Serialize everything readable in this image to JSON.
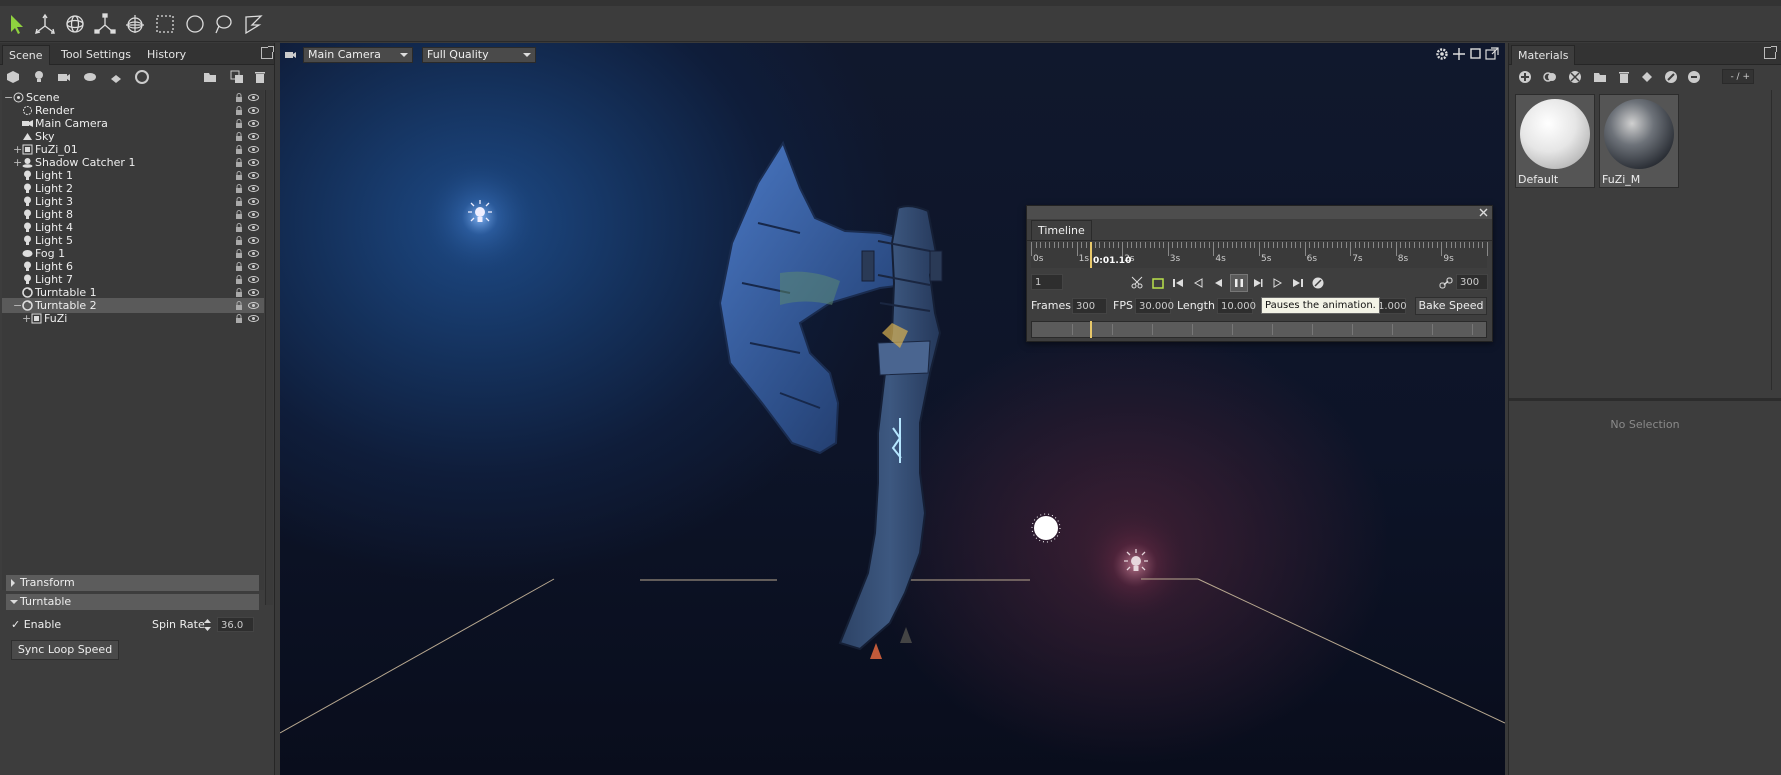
{
  "toolbar": {
    "tools": [
      "select-tool",
      "move-tool",
      "rotate-tool",
      "scale-tool",
      "transform-tool",
      "box-select-tool",
      "circle-select-tool",
      "lasso-select-tool",
      "paint-select-tool"
    ]
  },
  "left_panel": {
    "tabs": [
      "Scene",
      "Tool Settings",
      "History"
    ],
    "tree": [
      {
        "label": "Scene",
        "level": 0,
        "expander": "−",
        "icon": "scene-icon"
      },
      {
        "label": "Render",
        "level": 1,
        "expander": "",
        "icon": "render-icon"
      },
      {
        "label": "Main Camera",
        "level": 1,
        "expander": "",
        "icon": "camera-icon"
      },
      {
        "label": "Sky",
        "level": 1,
        "expander": "",
        "icon": "sky-icon"
      },
      {
        "label": "FuZi_01",
        "level": 1,
        "expander": "+",
        "icon": "mesh-icon"
      },
      {
        "label": "Shadow Catcher 1",
        "level": 1,
        "expander": "+",
        "icon": "shadow-catcher-icon"
      },
      {
        "label": "Light 1",
        "level": 1,
        "expander": "",
        "icon": "light-icon"
      },
      {
        "label": "Light 2",
        "level": 1,
        "expander": "",
        "icon": "light-icon"
      },
      {
        "label": "Light 3",
        "level": 1,
        "expander": "",
        "icon": "light-icon"
      },
      {
        "label": "Light 8",
        "level": 1,
        "expander": "",
        "icon": "light-icon"
      },
      {
        "label": "Light 4",
        "level": 1,
        "expander": "",
        "icon": "light-icon"
      },
      {
        "label": "Light 5",
        "level": 1,
        "expander": "",
        "icon": "light-icon"
      },
      {
        "label": "Fog 1",
        "level": 1,
        "expander": "",
        "icon": "fog-icon"
      },
      {
        "label": "Light 6",
        "level": 1,
        "expander": "",
        "icon": "light-icon"
      },
      {
        "label": "Light 7",
        "level": 1,
        "expander": "",
        "icon": "light-icon"
      },
      {
        "label": "Turntable 1",
        "level": 1,
        "expander": "",
        "icon": "turntable-icon"
      },
      {
        "label": "Turntable 2",
        "level": 1,
        "expander": "−",
        "icon": "turntable-icon",
        "selected": true
      },
      {
        "label": "FuZi",
        "level": 2,
        "expander": "+",
        "icon": "mesh-icon"
      }
    ],
    "sections": {
      "transform": "Transform",
      "turntable": "Turntable"
    },
    "enable_label": "Enable",
    "enable_check": "✓",
    "spin_rate_label": "Spin Rate",
    "spin_rate_value": "36.0",
    "sync_button": "Sync Loop Speed"
  },
  "viewport": {
    "camera_select": "Main Camera",
    "quality_select": "Full Quality"
  },
  "timeline": {
    "title": "Timeline",
    "ruler_labels": [
      "0s",
      "1s",
      "2s",
      "3s",
      "4s",
      "5s",
      "6s",
      "7s",
      "8s",
      "9s"
    ],
    "current_time": "0:01.10",
    "current_frame": "1",
    "end_frame": "300",
    "frames_label": "Frames",
    "frames_value": "300",
    "fps_label": "FPS",
    "fps_value": "30.000",
    "length_label": "Length",
    "length_value": "10.000",
    "speed_value": "1.000",
    "bake_button": "Bake Speed",
    "tooltip": "Pauses the animation."
  },
  "right_panel": {
    "tab": "Materials",
    "materials": [
      {
        "name": "Default"
      },
      {
        "name": "FuZi_M"
      }
    ],
    "zoom_text": "- / +",
    "no_selection": "No Selection"
  },
  "colors": {
    "accent_select": "#7ec23a",
    "panel": "#3d3d3d",
    "selected_row": "#5a5a5a"
  }
}
